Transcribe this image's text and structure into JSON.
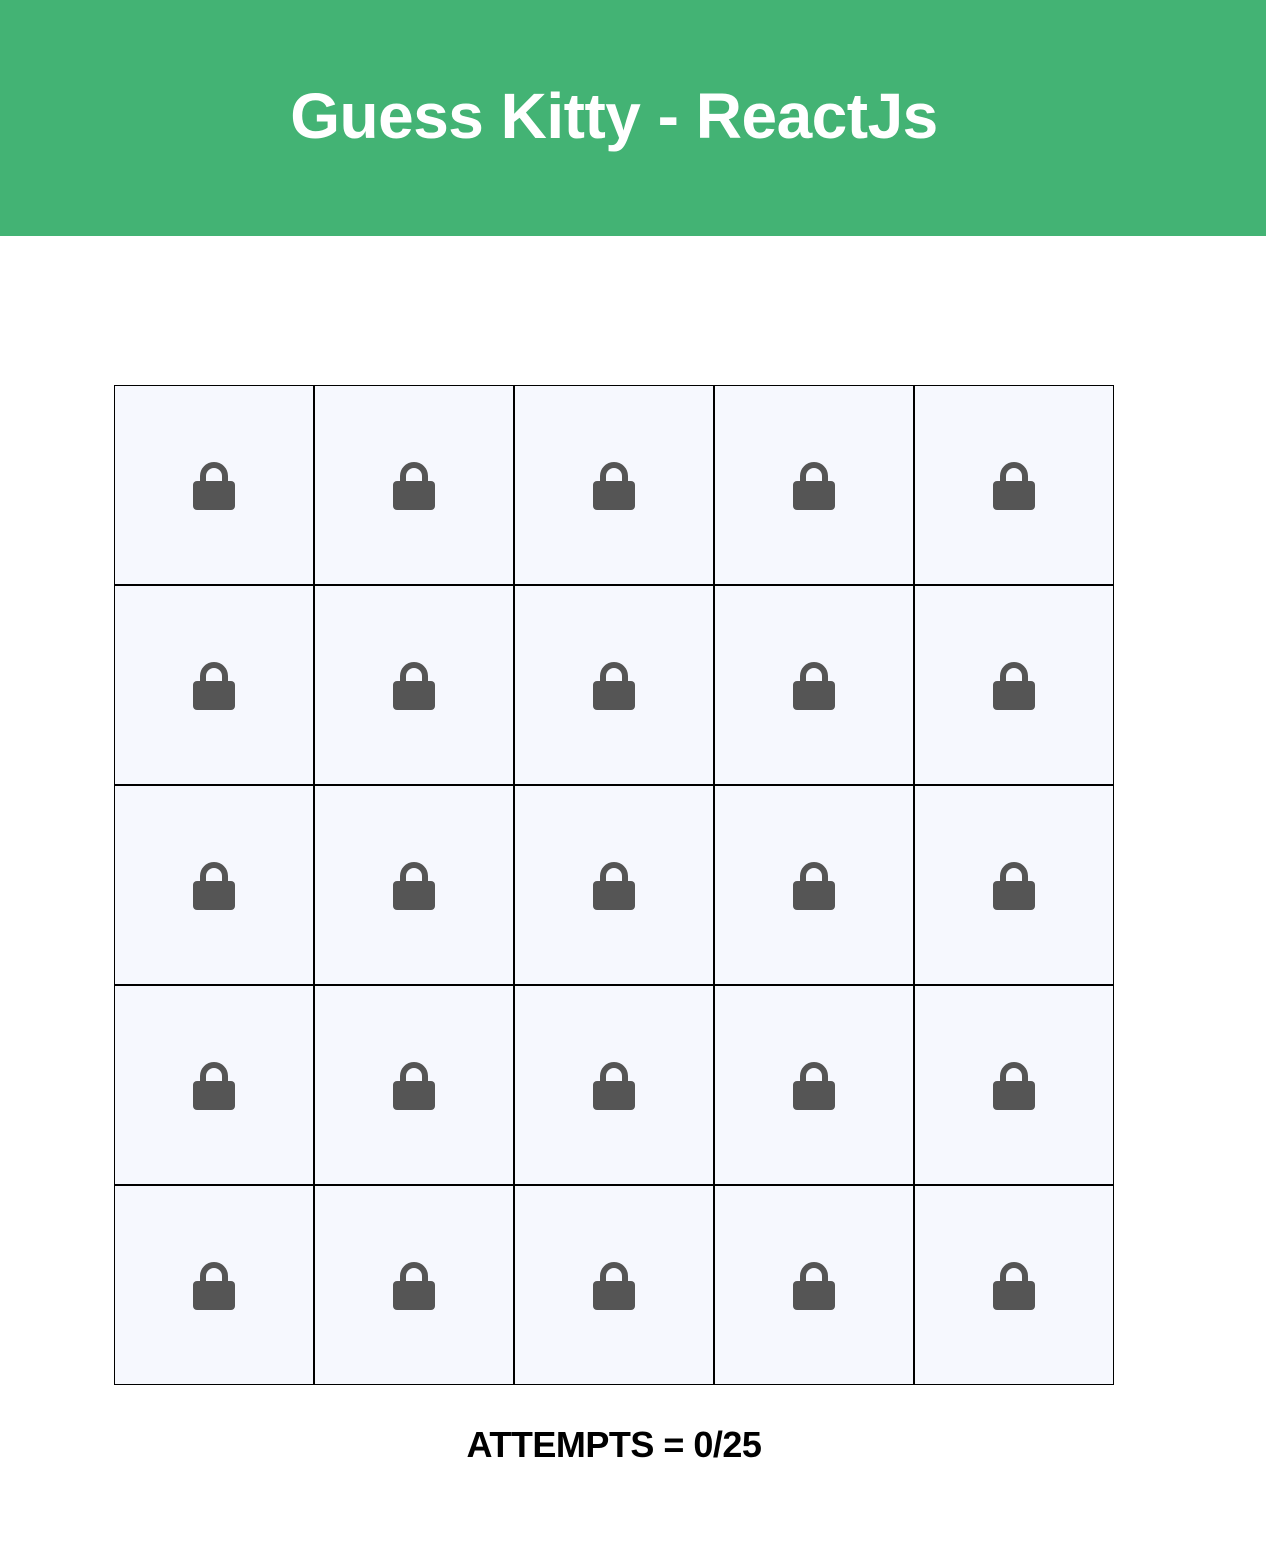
{
  "header": {
    "title": "Guess Kitty - ReactJs",
    "background_color": "#43b374"
  },
  "board": {
    "rows": 5,
    "columns": 5,
    "tile_icon": "lock-icon",
    "tile_background": "#f6f8fe",
    "icon_color": "#555555",
    "tiles": [
      {
        "state": "locked"
      },
      {
        "state": "locked"
      },
      {
        "state": "locked"
      },
      {
        "state": "locked"
      },
      {
        "state": "locked"
      },
      {
        "state": "locked"
      },
      {
        "state": "locked"
      },
      {
        "state": "locked"
      },
      {
        "state": "locked"
      },
      {
        "state": "locked"
      },
      {
        "state": "locked"
      },
      {
        "state": "locked"
      },
      {
        "state": "locked"
      },
      {
        "state": "locked"
      },
      {
        "state": "locked"
      },
      {
        "state": "locked"
      },
      {
        "state": "locked"
      },
      {
        "state": "locked"
      },
      {
        "state": "locked"
      },
      {
        "state": "locked"
      },
      {
        "state": "locked"
      },
      {
        "state": "locked"
      },
      {
        "state": "locked"
      },
      {
        "state": "locked"
      },
      {
        "state": "locked"
      }
    ]
  },
  "status": {
    "attempts_text": "ATTEMPTS = 0/25"
  }
}
